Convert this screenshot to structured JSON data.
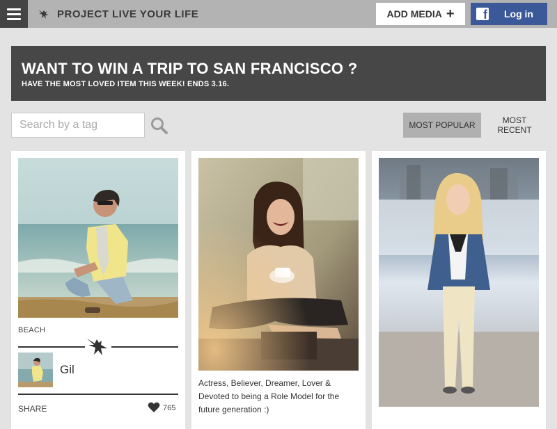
{
  "header": {
    "brand": "PROJECT LIVE YOUR LIFE",
    "add_media": "ADD MEDIA",
    "login": "Log in"
  },
  "banner": {
    "title": "WANT TO WIN A TRIP TO SAN FRANCISCO ?",
    "subtitle": "HAVE THE MOST LOVED ITEM THIS WEEK! ENDS 3.16."
  },
  "search": {
    "placeholder": "Search by a tag",
    "value": ""
  },
  "sort": {
    "popular": "MOST POPULAR",
    "recent": "MOST RECENT",
    "active": "popular"
  },
  "cards": [
    {
      "tag": "BEACH",
      "user": "Gil",
      "share": "SHARE",
      "likes": "765"
    },
    {
      "caption": "Actress, Believer, Dreamer, Lover & Devoted to being a Role Model for the future generation :)"
    },
    {}
  ],
  "colors": {
    "topbar": "#b3b3b3",
    "menu_bg": "#444444",
    "banner_bg": "#474747",
    "facebook": "#3b5998",
    "active_tab": "#b0b0b0",
    "page_bg": "#e3e3e3"
  },
  "icons": {
    "menu": "hamburger-icon",
    "brand": "eagle-icon",
    "add": "plus-icon",
    "facebook": "facebook-icon",
    "search": "search-icon",
    "like": "heart-icon"
  }
}
